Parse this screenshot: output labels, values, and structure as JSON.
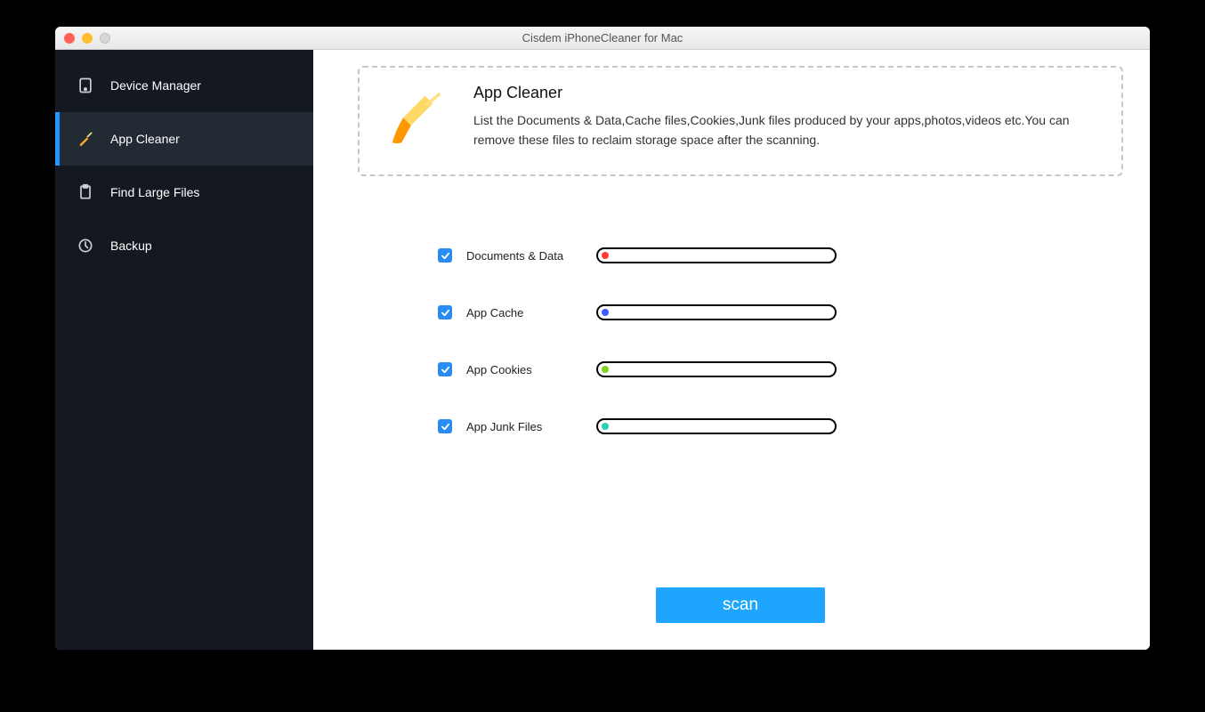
{
  "window": {
    "title": "Cisdem iPhoneCleaner for Mac"
  },
  "sidebar": {
    "items": [
      {
        "label": "Device Manager",
        "icon": "device-icon",
        "active": false
      },
      {
        "label": "App Cleaner",
        "icon": "broom-icon",
        "active": true
      },
      {
        "label": "Find Large Files",
        "icon": "clipboard-icon",
        "active": false
      },
      {
        "label": "Backup",
        "icon": "refresh-icon",
        "active": false
      }
    ]
  },
  "panel": {
    "title": "App Cleaner",
    "description": "List the Documents & Data,Cache files,Cookies,Junk files produced by your apps,photos,videos etc.You can remove these files to reclaim storage space after the scanning."
  },
  "categories": [
    {
      "label": "Documents & Data",
      "checked": true,
      "dot_color": "#ff3b30"
    },
    {
      "label": "App Cache",
      "checked": true,
      "dot_color": "#3b5cff"
    },
    {
      "label": "App Cookies",
      "checked": true,
      "dot_color": "#7ed321"
    },
    {
      "label": "App Junk Files",
      "checked": true,
      "dot_color": "#2ad1b1"
    }
  ],
  "actions": {
    "scan_label": "scan"
  }
}
